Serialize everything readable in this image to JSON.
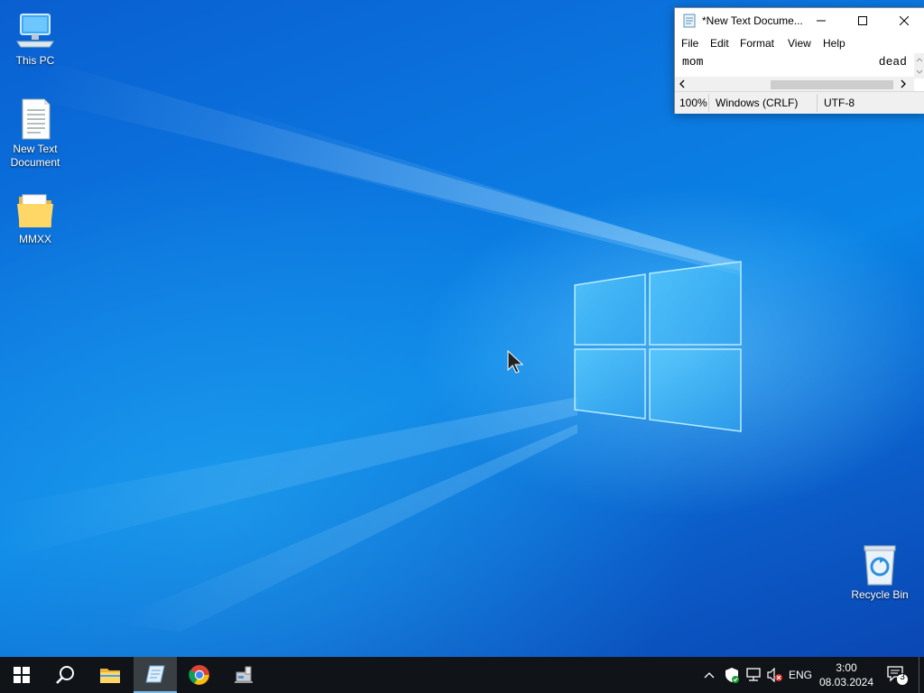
{
  "desktop": {
    "icons": [
      {
        "label": "This PC",
        "icon": "this-pc-icon"
      },
      {
        "label": "New Text Document",
        "icon": "text-document-icon"
      },
      {
        "label": "MMXX",
        "icon": "folder-icon"
      },
      {
        "label": "Recycle Bin",
        "icon": "recycle-bin-icon"
      }
    ]
  },
  "notepad": {
    "title": "*New Text Docume...",
    "menu": [
      "File",
      "Edit",
      "Format",
      "View",
      "Help"
    ],
    "text_left": "mom",
    "text_right": "dead",
    "status": {
      "zoom": "100%",
      "line_ending": "Windows (CRLF)",
      "encoding": "UTF-8"
    }
  },
  "taskbar": {
    "apps": [
      "start-icon",
      "search-icon",
      "file-explorer-icon",
      "notepad-icon",
      "chrome-icon",
      "network-drive-icon"
    ],
    "tray": {
      "language": "ENG",
      "time": "3:00",
      "date": "08.03.2024",
      "notification_count": "3"
    }
  },
  "colors": {
    "taskbar": "#101418",
    "wallpaper_blue": "#0a78e0",
    "active_app_underline": "#76b9ed"
  }
}
